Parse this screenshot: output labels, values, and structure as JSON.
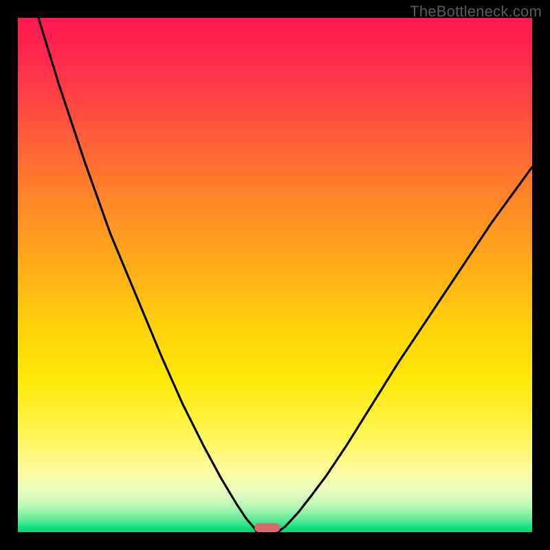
{
  "watermark": "TheBottleneck.com",
  "chart_data": {
    "type": "line",
    "title": "",
    "xlabel": "",
    "ylabel": "",
    "xlim": [
      0,
      100
    ],
    "ylim": [
      0,
      100
    ],
    "grid": false,
    "series": [
      {
        "name": "left-curve",
        "x": [
          4,
          8,
          13,
          18,
          23,
          28,
          32,
          36,
          39.5,
          42.5,
          44.5,
          46,
          46.5
        ],
        "y": [
          100,
          87,
          72,
          58,
          46,
          34,
          25,
          17,
          10.5,
          5.5,
          2.5,
          0.8,
          0
        ]
      },
      {
        "name": "right-curve",
        "x": [
          50.5,
          52,
          54.5,
          57,
          60,
          64,
          69,
          74,
          80,
          86,
          92,
          100
        ],
        "y": [
          0,
          1.1,
          3.8,
          7,
          11,
          17,
          25,
          33,
          42,
          51,
          60,
          71
        ]
      }
    ],
    "marker": {
      "name": "optimal-marker",
      "x_range": [
        46,
        51
      ],
      "y": 0,
      "color": "#d86a6f"
    },
    "background_gradient": {
      "top": "#ff1752",
      "mid": "#ffe706",
      "bottom": "#00d37d"
    }
  }
}
